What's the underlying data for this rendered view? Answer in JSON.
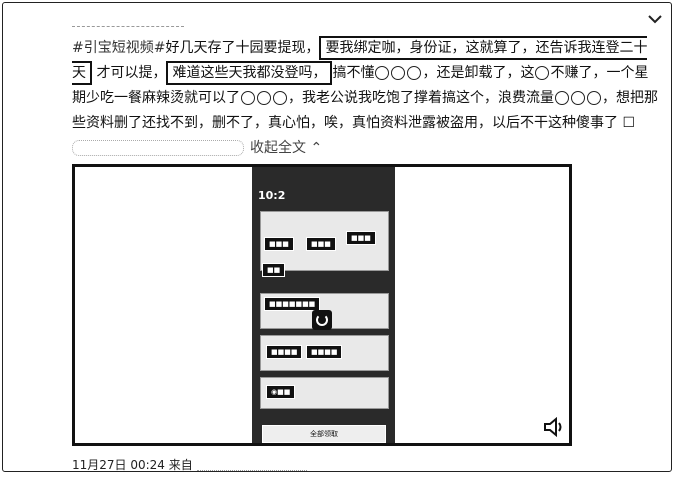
{
  "post": {
    "hashtag": "#引宝短视频#",
    "text_part1": "好几天存了十园要提现，",
    "highlight1": "要我绑定咖，身份证，这就算了，还告诉我连登二十天",
    "text_part2": "才可以提，",
    "highlight2": "难道这些天我都没登吗，",
    "text_part3": "搞不懂",
    "text_part4": "，还是卸载了，这",
    "text_part5": "不赚了，一个星期少吃一餐麻辣烫就可以了",
    "text_part6": "，我老公说我吃饱了撑着搞这个，浪费流量",
    "text_part7": "，想把那些资料删了还找不到，删不了，真心怕，唉，真怕资料泄露被盗用，以后不干这种傻事了",
    "collapse_label": "收起全文"
  },
  "video": {
    "phone_time": "10:2",
    "bottom_button": "全部领取"
  },
  "footer": {
    "timestamp": "11月27日 00:24",
    "source_prefix": "来自"
  }
}
